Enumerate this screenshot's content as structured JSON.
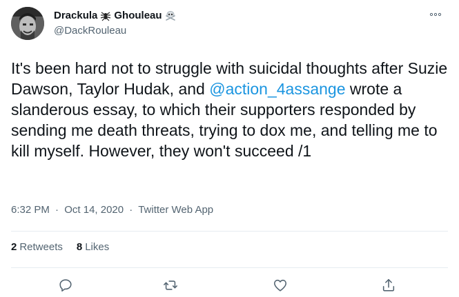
{
  "user": {
    "display_name": "Drackula",
    "display_name_suffix": "Ghouleau",
    "handle": "@DackRouleau",
    "emoji_1": "spider-icon",
    "emoji_2": "skull-crossbones-icon"
  },
  "tweet": {
    "text_before_mention": "It's been hard not to struggle with suicidal thoughts after Suzie Dawson, Taylor Hudak, and ",
    "mention": "@action_4assange",
    "text_after_mention": " wrote a slanderous essay, to which their supporters responded by sending me death threats, trying to dox me, and telling me to kill myself. However, they won't succeed /1",
    "time": "6:32 PM",
    "date": "Oct 14, 2020",
    "separator": "·",
    "source": "Twitter Web App"
  },
  "stats": {
    "retweets_count": "2",
    "retweets_label": "Retweets",
    "likes_count": "8",
    "likes_label": "Likes"
  },
  "actions": [
    "reply-icon",
    "retweet-icon",
    "like-icon",
    "share-icon"
  ],
  "colors": {
    "link": "#1b95e0",
    "secondary_text": "#536471",
    "icon": "#536471",
    "divider": "#e6ecf0"
  }
}
